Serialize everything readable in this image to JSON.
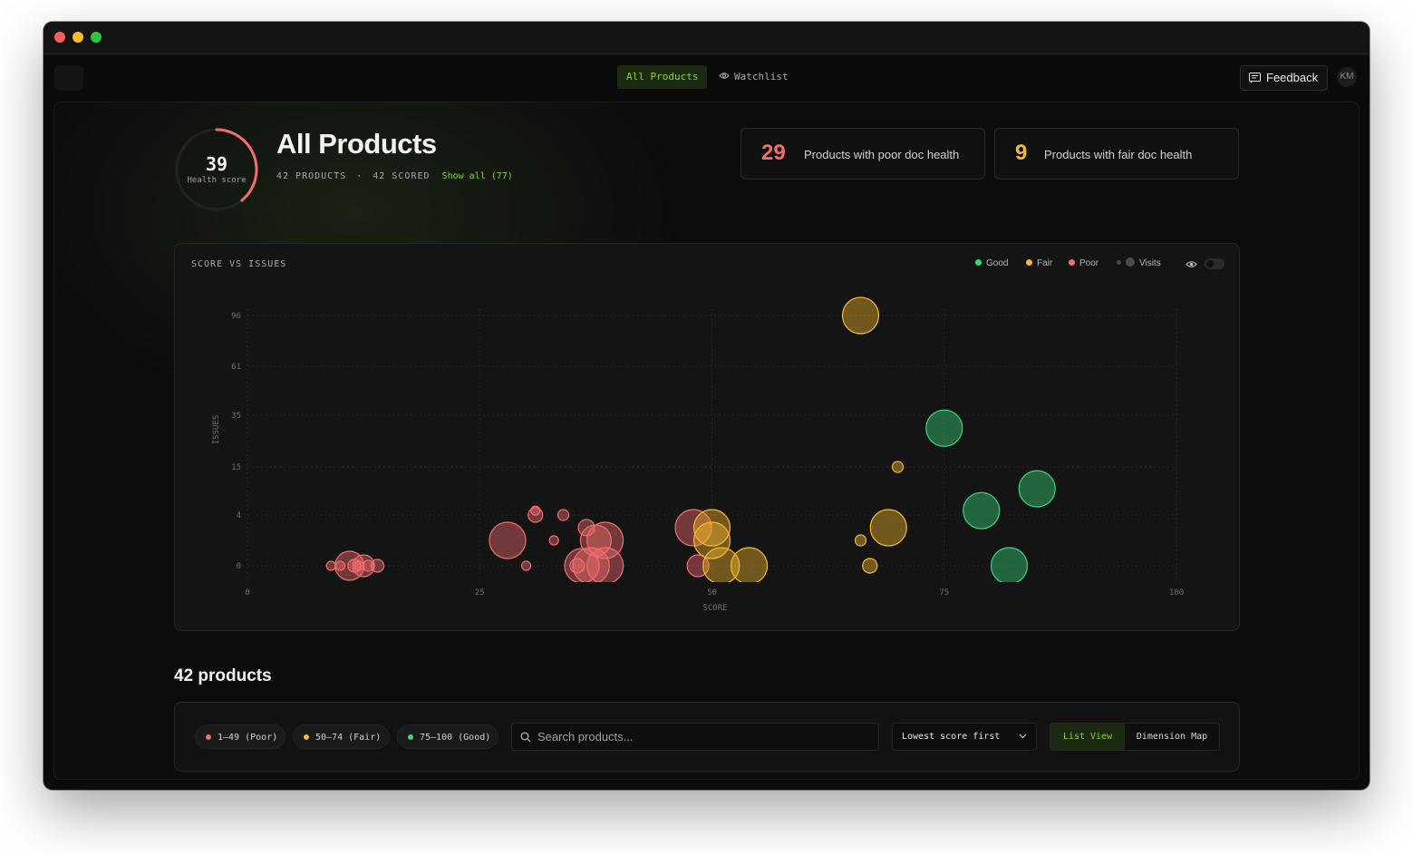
{
  "window": {
    "traffic_lights": [
      "close",
      "minimize",
      "maximize"
    ]
  },
  "nav": {
    "tabs": [
      {
        "label": "All Products",
        "active": true
      },
      {
        "label": "Watchlist",
        "active": false,
        "icon": "eye-icon"
      }
    ],
    "feedback_label": "Feedback",
    "avatar_initials": "KM"
  },
  "header": {
    "health_score": "39",
    "health_score_value": 39,
    "health_label": "Health score",
    "title": "All Products",
    "products_count": "42 PRODUCTS",
    "separator": "·",
    "scored_count": "42 SCORED",
    "show_all_label": "Show all (77)"
  },
  "stats": [
    {
      "value": "29",
      "label": "Products with poor doc health",
      "color": "#f26d6d"
    },
    {
      "value": "9",
      "label": "Products with fair doc health",
      "color": "#f5b82e"
    }
  ],
  "colors": {
    "good": "#3ad67a",
    "fair": "#f5b82e",
    "poor": "#f26d6d",
    "accent": "#86d13a"
  },
  "chart_data": {
    "type": "scatter",
    "title": "SCORE VS ISSUES",
    "xlabel": "SCORE",
    "ylabel": "ISSUES",
    "x_ticks": [
      "0",
      "25",
      "50",
      "75",
      "100"
    ],
    "y_ticks": [
      "0",
      "4",
      "15",
      "35",
      "61",
      "96"
    ],
    "xlim": [
      0,
      100
    ],
    "y_scale": "categorical-ticks",
    "grid": true,
    "legend": [
      {
        "name": "Good",
        "color": "#3ad67a"
      },
      {
        "name": "Fair",
        "color": "#f5b82e"
      },
      {
        "name": "Poor",
        "color": "#f26d6d"
      },
      {
        "name": "Visits",
        "color": "#555555"
      }
    ],
    "legend_position": "top-right",
    "series": [
      {
        "name": "Poor",
        "points": [
          {
            "x": 9,
            "y": 0,
            "r": 5
          },
          {
            "x": 10,
            "y": 0,
            "r": 5
          },
          {
            "x": 11,
            "y": 0,
            "r": 16
          },
          {
            "x": 11.5,
            "y": 0,
            "r": 7
          },
          {
            "x": 12,
            "y": 0,
            "r": 5
          },
          {
            "x": 12.5,
            "y": 0,
            "r": 12
          },
          {
            "x": 13,
            "y": 0,
            "r": 6
          },
          {
            "x": 14,
            "y": 0,
            "r": 7
          },
          {
            "x": 28,
            "y": 2,
            "r": 20
          },
          {
            "x": 30,
            "y": 0,
            "r": 5
          },
          {
            "x": 31,
            "y": 4,
            "r": 8
          },
          {
            "x": 31,
            "y": 5,
            "r": 5
          },
          {
            "x": 33,
            "y": 2,
            "r": 5
          },
          {
            "x": 34,
            "y": 4,
            "r": 6
          },
          {
            "x": 36,
            "y": 0,
            "r": 19
          },
          {
            "x": 35.5,
            "y": 0,
            "r": 8
          },
          {
            "x": 36.5,
            "y": 3,
            "r": 9
          },
          {
            "x": 37,
            "y": 0,
            "r": 20
          },
          {
            "x": 37.5,
            "y": 2,
            "r": 17
          },
          {
            "x": 38.5,
            "y": 2,
            "r": 20
          },
          {
            "x": 38.5,
            "y": 0,
            "r": 20
          },
          {
            "x": 48,
            "y": 3,
            "r": 20
          },
          {
            "x": 48.5,
            "y": 0,
            "r": 12
          }
        ]
      },
      {
        "name": "Fair",
        "points": [
          {
            "x": 50,
            "y": 3,
            "r": 20
          },
          {
            "x": 50,
            "y": 2,
            "r": 20
          },
          {
            "x": 51,
            "y": 0,
            "r": 20
          },
          {
            "x": 54,
            "y": 0,
            "r": 20
          },
          {
            "x": 66,
            "y": 96,
            "r": 20
          },
          {
            "x": 66,
            "y": 2,
            "r": 6
          },
          {
            "x": 67,
            "y": 0,
            "r": 8
          },
          {
            "x": 70,
            "y": 15,
            "r": 6
          },
          {
            "x": 69,
            "y": 3,
            "r": 20
          }
        ]
      },
      {
        "name": "Good",
        "points": [
          {
            "x": 75,
            "y": 30,
            "r": 20
          },
          {
            "x": 79,
            "y": 5,
            "r": 20
          },
          {
            "x": 82,
            "y": 0,
            "r": 20
          },
          {
            "x": 85,
            "y": 10,
            "r": 20
          }
        ]
      }
    ]
  },
  "products": {
    "heading": "42 products",
    "filters": [
      {
        "label": "1–49 (Poor)",
        "color": "#f26d6d"
      },
      {
        "label": "50–74 (Fair)",
        "color": "#f5b82e"
      },
      {
        "label": "75–100 (Good)",
        "color": "#3ad67a"
      }
    ],
    "search_placeholder": "Search products...",
    "sort_value": "Lowest score first",
    "view_options": [
      "List View",
      "Dimension Map"
    ],
    "active_view": "List View"
  }
}
